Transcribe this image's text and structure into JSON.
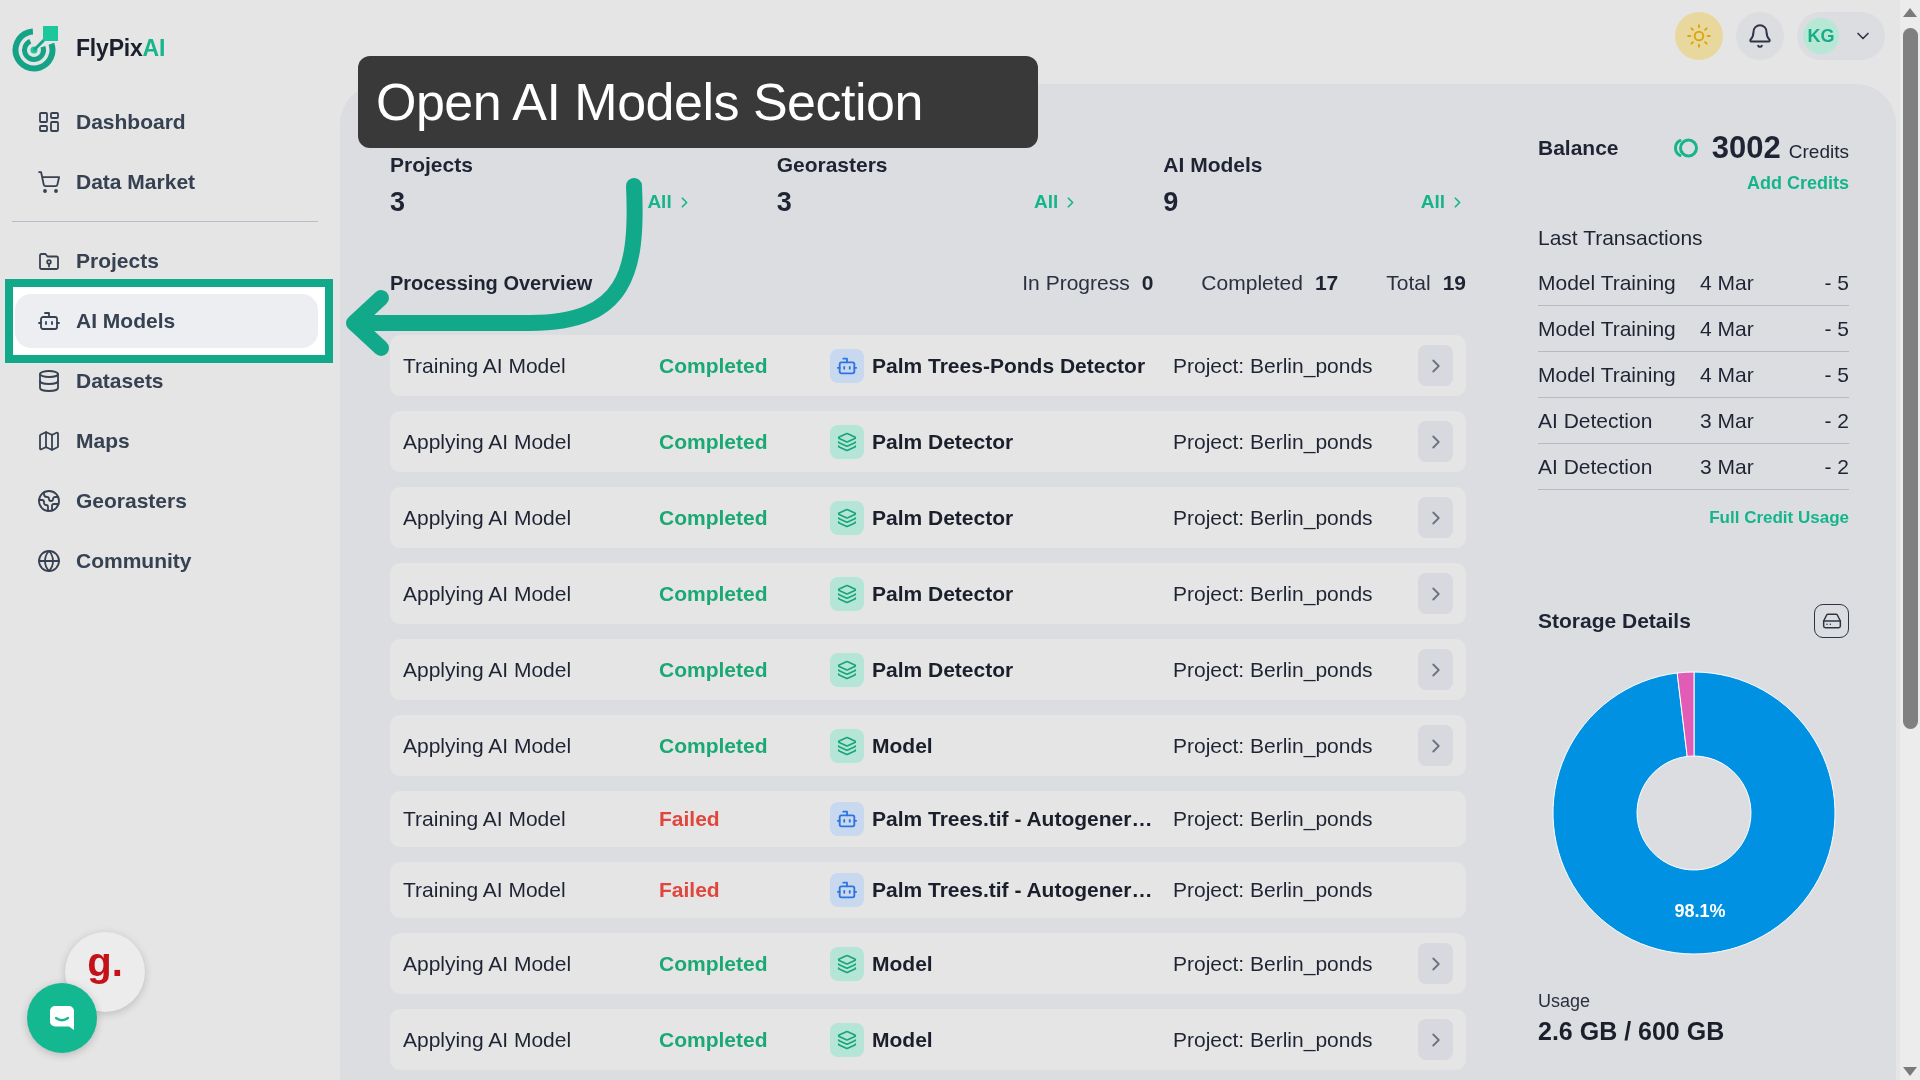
{
  "brand": {
    "name": "FlyPix",
    "accent": "AI"
  },
  "sidebar": {
    "groups": [
      {
        "items": [
          {
            "label": "Dashboard",
            "selected": false,
            "highlighted": false
          },
          {
            "label": "Data Market",
            "selected": false,
            "highlighted": false
          }
        ]
      },
      {
        "items": [
          {
            "label": "Projects",
            "selected": false,
            "highlighted": false
          },
          {
            "label": "AI Models",
            "selected": true,
            "highlighted": true
          },
          {
            "label": "Datasets",
            "selected": false,
            "highlighted": false
          },
          {
            "label": "Maps",
            "selected": false,
            "highlighted": false
          },
          {
            "label": "Georasters",
            "selected": false,
            "highlighted": false
          },
          {
            "label": "Community",
            "selected": false,
            "highlighted": false
          }
        ]
      }
    ]
  },
  "header": {
    "avatar_initials": "KG"
  },
  "tutorial": {
    "callout": "Open AI Models Section"
  },
  "summary_cards": [
    {
      "title": "Projects",
      "count": "3",
      "link": "All"
    },
    {
      "title": "Georasters",
      "count": "3",
      "link": "All"
    },
    {
      "title": "AI Models",
      "count": "9",
      "link": "All"
    }
  ],
  "processing": {
    "title": "Processing Overview",
    "stats": [
      {
        "label": "In Progress",
        "value": "0"
      },
      {
        "label": "Completed",
        "value": "17"
      },
      {
        "label": "Total",
        "value": "19"
      }
    ],
    "rows": [
      {
        "kind": "training",
        "task": "Training AI Model",
        "status": "Completed",
        "failed": false,
        "model": "Palm Trees-Ponds Detector",
        "project": "Project: Berlin_ponds",
        "details_button": true
      },
      {
        "kind": "applying",
        "task": "Applying AI Model",
        "status": "Completed",
        "failed": false,
        "model": "Palm Detector",
        "project": "Project: Berlin_ponds",
        "details_button": true
      },
      {
        "kind": "applying",
        "task": "Applying AI Model",
        "status": "Completed",
        "failed": false,
        "model": "Palm Detector",
        "project": "Project: Berlin_ponds",
        "details_button": true
      },
      {
        "kind": "applying",
        "task": "Applying AI Model",
        "status": "Completed",
        "failed": false,
        "model": "Palm Detector",
        "project": "Project: Berlin_ponds",
        "details_button": true
      },
      {
        "kind": "applying",
        "task": "Applying AI Model",
        "status": "Completed",
        "failed": false,
        "model": "Palm Detector",
        "project": "Project: Berlin_ponds",
        "details_button": true
      },
      {
        "kind": "applying",
        "task": "Applying AI Model",
        "status": "Completed",
        "failed": false,
        "model": "Model",
        "project": "Project: Berlin_ponds",
        "details_button": true
      },
      {
        "kind": "training",
        "task": "Training AI Model",
        "status": "Failed",
        "failed": true,
        "model": "Palm Trees.tif - Autogener…",
        "project": "Project: Berlin_ponds",
        "details_button": false
      },
      {
        "kind": "training",
        "task": "Training AI Model",
        "status": "Failed",
        "failed": true,
        "model": "Palm Trees.tif - Autogener…",
        "project": "Project: Berlin_ponds",
        "details_button": false
      },
      {
        "kind": "applying",
        "task": "Applying AI Model",
        "status": "Completed",
        "failed": false,
        "model": "Model",
        "project": "Project: Berlin_ponds",
        "details_button": true
      },
      {
        "kind": "applying",
        "task": "Applying AI Model",
        "status": "Completed",
        "failed": false,
        "model": "Model",
        "project": "Project: Berlin_ponds",
        "details_button": true
      }
    ]
  },
  "balance": {
    "title": "Balance",
    "amount": "3002",
    "unit": "Credits",
    "link": "Add Credits"
  },
  "transactions": {
    "title": "Last Transactions",
    "items": [
      {
        "name": "Model Training",
        "date": "4 Mar",
        "amount": "- 5"
      },
      {
        "name": "Model Training",
        "date": "4 Mar",
        "amount": "- 5"
      },
      {
        "name": "Model Training",
        "date": "4 Mar",
        "amount": "- 5"
      },
      {
        "name": "AI Detection",
        "date": "3 Mar",
        "amount": "- 2"
      },
      {
        "name": "AI Detection",
        "date": "3 Mar",
        "amount": "- 2"
      }
    ],
    "link": "Full Credit Usage"
  },
  "storage": {
    "title": "Storage Details",
    "chart_data": {
      "type": "donut",
      "values": [
        98.1,
        1.9
      ],
      "value_labels": [
        "98.1%",
        null
      ]
    },
    "usage_label": "Usage",
    "usage_value": "2.6 GB / 600 GB"
  },
  "widgets": {
    "badge_text": "g."
  }
}
